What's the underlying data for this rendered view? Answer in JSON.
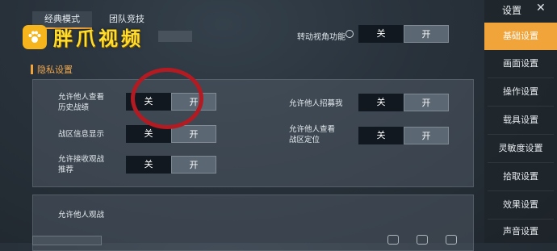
{
  "tabs": [
    "经典模式",
    "团队竞技"
  ],
  "watermark": "胖爪视频",
  "top_setting": {
    "label": "转动视角功能",
    "off": "关",
    "on": "开"
  },
  "section_title": "隐私设置",
  "privacy": {
    "history": {
      "label_line1": "允许他人查看",
      "label_line2": "历史战绩",
      "off": "关",
      "on": "开"
    },
    "recruit": {
      "label": "允许他人招募我",
      "off": "关",
      "on": "开"
    },
    "region_display": {
      "label": "战区信息显示",
      "off": "关",
      "on": "开"
    },
    "region_location": {
      "label_line1": "允许他人查看",
      "label_line2": "战区定位",
      "off": "关",
      "on": "开"
    },
    "spectate_recommend": {
      "label_line1": "允许接收观战",
      "label_line2": "推荐",
      "off": "关",
      "on": "开"
    },
    "spectate": {
      "label": "允许他人观战"
    }
  },
  "sidebar": {
    "title": "设置",
    "items": [
      "基础设置",
      "画面设置",
      "操作设置",
      "载具设置",
      "灵敏度设置",
      "拾取设置",
      "效果设置",
      "声音设置"
    ]
  },
  "colors": {
    "accent": "#f0a43a",
    "highlight_circle": "#b21b22",
    "watermark": "#ffdd2c"
  },
  "icons": {
    "logo": "paw-icon",
    "info": "info-icon",
    "close": "close-icon"
  }
}
